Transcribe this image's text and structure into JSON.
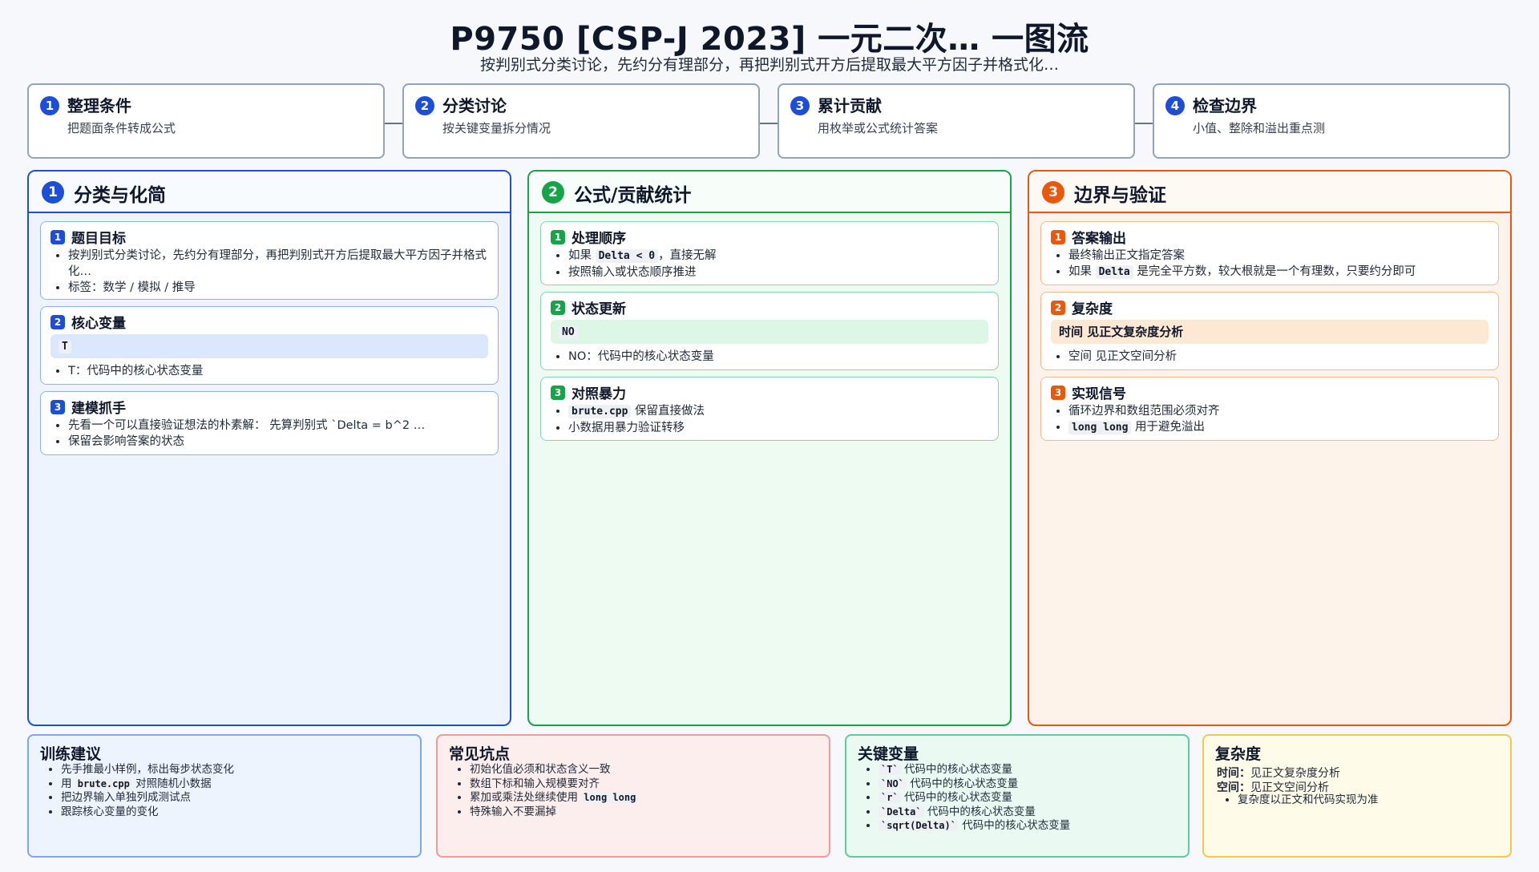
{
  "title": "P9750 [CSP-J 2023] 一元二次… 一图流",
  "subtitle": "按判别式分类讨论，先约分有理部分，再把判别式开方后提取最大平方因子并格式化…",
  "steps": [
    {
      "num": "1",
      "title": "整理条件",
      "desc": "把题面条件转成公式"
    },
    {
      "num": "2",
      "title": "分类讨论",
      "desc": "按关键变量拆分情况"
    },
    {
      "num": "3",
      "title": "累计贡献",
      "desc": "用枚举或公式统计答案"
    },
    {
      "num": "4",
      "title": "检查边界",
      "desc": "小值、整除和溢出重点测"
    }
  ],
  "columns": [
    {
      "num": "1",
      "title": "分类与化简",
      "cards": [
        {
          "num": "1",
          "title": "题目目标",
          "items": [
            "按判别式分类讨论，先约分有理部分，再把判别式开方后提取最大平方因子并格式化…",
            "标签：数学 / 模拟 / 推导"
          ]
        },
        {
          "num": "2",
          "title": "核心变量",
          "highlight": "T",
          "items": [
            "T：代码中的核心状态变量"
          ]
        },
        {
          "num": "3",
          "title": "建模抓手",
          "items": [
            "先看一个可以直接验证想法的朴素解：  先算判别式 `Delta = b^2 …",
            "保留会影响答案的状态"
          ]
        }
      ]
    },
    {
      "num": "2",
      "title": "公式/贡献统计",
      "cards": [
        {
          "num": "1",
          "title": "处理顺序",
          "item1_pre": "如果 ",
          "item1_code": "Delta < 0",
          "item1_post": "，直接无解",
          "item2": "按照输入或状态顺序推进"
        },
        {
          "num": "2",
          "title": "状态更新",
          "highlight": "NO",
          "items": [
            "NO：代码中的核心状态变量"
          ]
        },
        {
          "num": "3",
          "title": "对照暴力",
          "item1_code": "brute.cpp",
          "item1_post": " 保留直接做法",
          "item2": "小数据用暴力验证转移"
        }
      ]
    },
    {
      "num": "3",
      "title": "边界与验证",
      "cards": [
        {
          "num": "1",
          "title": "答案输出",
          "item1": "最终输出正文指定答案",
          "item2_pre": "如果 ",
          "item2_code": "Delta",
          "item2_post": " 是完全平方数，较大根就是一个有理数，只要约分即可"
        },
        {
          "num": "2",
          "title": "复杂度",
          "highlight": "时间 见正文复杂度分析",
          "items": [
            "空间 见正文空间分析"
          ]
        },
        {
          "num": "3",
          "title": "实现信号",
          "item1": "循环边界和数组范围必须对齐",
          "item2_code": "long long",
          "item2_post": " 用于避免溢出"
        }
      ]
    }
  ],
  "bottom": {
    "training": {
      "title": "训练建议",
      "i1": "先手推最小样例，标出每步状态变化",
      "i2_pre": "用 ",
      "i2_code": "brute.cpp",
      "i2_post": " 对照随机小数据",
      "i3": "把边界输入单独列成测试点",
      "i4": "跟踪核心变量的变化"
    },
    "pitfalls": {
      "title": "常见坑点",
      "i1": "初始化值必须和状态含义一致",
      "i2": "数组下标和输入规模要对齐",
      "i3_pre": "累加或乘法处继续使用 ",
      "i3_code": "long long",
      "i4": "特殊输入不要漏掉"
    },
    "key_vars": {
      "title": "关键变量",
      "items": [
        {
          "code": "`T`",
          "text": " 代码中的核心状态变量"
        },
        {
          "code": "`NO`",
          "text": " 代码中的核心状态变量"
        },
        {
          "code": "`r`",
          "text": " 代码中的核心状态变量"
        },
        {
          "code": "`Delta`",
          "text": " 代码中的核心状态变量"
        },
        {
          "code": "`sqrt(Delta)`",
          "text": " 代码中的核心状态变量"
        }
      ]
    },
    "complexity": {
      "title": "复杂度",
      "time_label": "时间：",
      "time_text": "见正文复杂度分析",
      "space_label": "空间：",
      "space_text": "见正文空间分析",
      "note": "复杂度以正文和代码实现为准"
    }
  },
  "colors": {
    "blue": "#1d4ed8",
    "green": "#16a34a",
    "orange": "#ea580c",
    "blue_highlight": "#dbe7fd",
    "green_highlight": "#dcf7e5",
    "orange_highlight": "#fde8d3"
  }
}
